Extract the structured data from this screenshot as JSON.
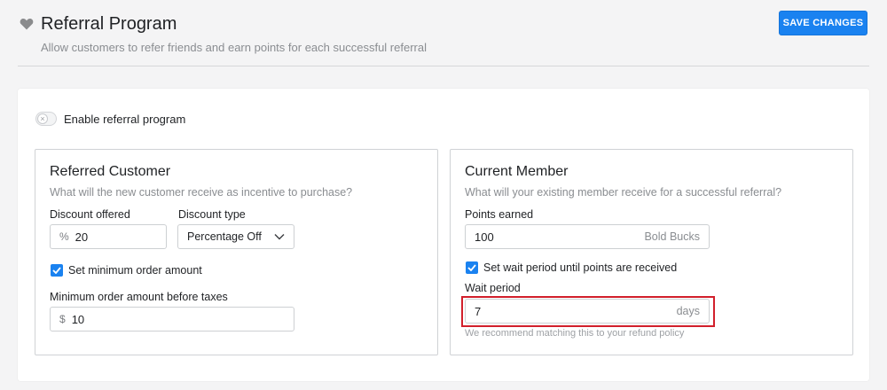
{
  "header": {
    "title": "Referral Program",
    "subtitle": "Allow customers to refer friends and earn points for each successful referral",
    "save_label": "SAVE CHANGES"
  },
  "toggle": {
    "label": "Enable referral program",
    "enabled": false
  },
  "referred_customer": {
    "title": "Referred Customer",
    "description": "What will the new customer receive as incentive to purchase?",
    "discount_offered_label": "Discount offered",
    "discount_prefix": "%",
    "discount_value": "20",
    "discount_type_label": "Discount type",
    "discount_type_value": "Percentage Off",
    "min_order_checkbox_label": "Set minimum order amount",
    "min_order_checked": true,
    "min_order_label": "Minimum order amount before taxes",
    "min_order_prefix": "$",
    "min_order_value": "10"
  },
  "current_member": {
    "title": "Current Member",
    "description": "What will your existing member receive for a successful referral?",
    "points_label": "Points earned",
    "points_value": "100",
    "points_suffix": "Bold Bucks",
    "wait_checkbox_label": "Set wait period until points are received",
    "wait_checked": true,
    "wait_label": "Wait period",
    "wait_value": "7",
    "wait_suffix": "days",
    "help_text": "We recommend matching this to your refund policy"
  },
  "colors": {
    "accent": "#1a82f0",
    "highlight": "#d21f2b"
  }
}
